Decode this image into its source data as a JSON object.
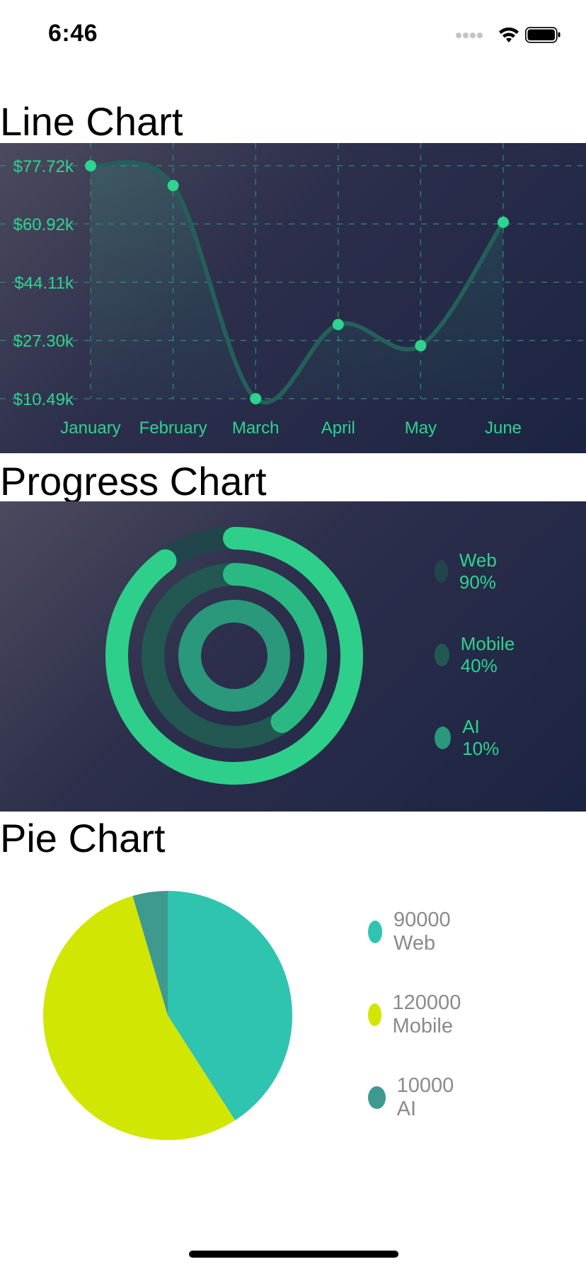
{
  "status_bar": {
    "time": "6:46"
  },
  "sections": {
    "line_title": "Line Chart",
    "progress_title": "Progress Chart",
    "pie_title": "Pie Chart"
  },
  "colors": {
    "accent": "#2ed38f",
    "panel_gradient": [
      "#4b4a5e",
      "#2d2f4c",
      "#1b2442"
    ],
    "pie_web": "#2ec4b0",
    "pie_mobile": "#d2e603",
    "pie_ai": "#3e9a8e"
  },
  "chart_data": [
    {
      "type": "line",
      "title": "Line Chart",
      "categories": [
        "January",
        "February",
        "March",
        "April",
        "May",
        "June"
      ],
      "y_tick_labels": [
        "$77.72k",
        "$60.92k",
        "$44.11k",
        "$27.30k",
        "$10.49k"
      ],
      "y_ticks": [
        77.72,
        60.92,
        44.11,
        27.3,
        10.49
      ],
      "ylim": [
        10.49,
        77.72
      ],
      "series": [
        {
          "values": [
            77.7,
            72.0,
            10.5,
            31.9,
            25.8,
            61.4
          ]
        }
      ],
      "grid": true,
      "curve": "smooth",
      "fill_area": true
    },
    {
      "type": "radial-progress",
      "title": "Progress Chart",
      "series": [
        {
          "name": "Web",
          "percent": 90,
          "label": "Web 90%",
          "color": "#2ecf8a",
          "track_color": "#21454b"
        },
        {
          "name": "Mobile",
          "percent": 40,
          "label": "Mobile 40%",
          "color": "#2bb983",
          "track_color": "#235752"
        },
        {
          "name": "AI",
          "percent": 10,
          "label": "AI 10%",
          "color": "#29987b",
          "track_color": "#29987b"
        }
      ]
    },
    {
      "type": "pie",
      "title": "Pie Chart",
      "slices": [
        {
          "name": "Web",
          "value": 90000,
          "label": "90000 Web",
          "color": "#2ec4b0"
        },
        {
          "name": "Mobile",
          "value": 120000,
          "label": "120000 Mobile",
          "color": "#d2e603"
        },
        {
          "name": "AI",
          "value": 10000,
          "label": "10000 AI",
          "color": "#3e9a8e"
        }
      ],
      "legend_position": "right"
    }
  ]
}
